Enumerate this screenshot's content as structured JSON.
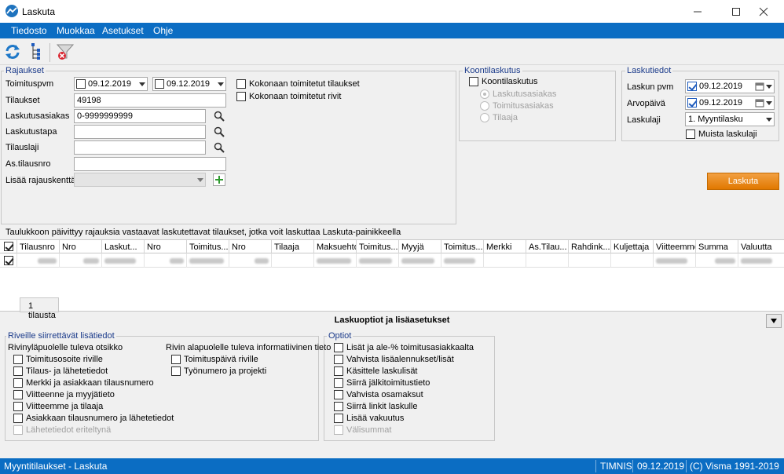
{
  "window": {
    "title": "Laskuta"
  },
  "menu": [
    "Tiedosto",
    "Muokkaa",
    "Asetukset",
    "Ohje"
  ],
  "rajaukset": {
    "title": "Rajaukset",
    "toimituspvm_label": "Toimituspvm",
    "date_from": "09.12.2019",
    "date_to": "09.12.2019",
    "tilaukset_label": "Tilaukset",
    "tilaukset_value": "49198",
    "laskutusasiakas_label": "Laskutusasiakas",
    "laskutusasiakas_value": "0-9999999999",
    "laskutustapa_label": "Laskutustapa",
    "tilauslaji_label": "Tilauslaji",
    "astilausnro_label": "As.tilausnro",
    "lisaa_label": "Lisää rajauskenttä",
    "kokonaan_tilaukset": "Kokonaan toimitetut tilaukset",
    "kokonaan_rivit": "Kokonaan toimitetut rivit"
  },
  "koonti": {
    "title": "Koontilaskutus",
    "checkbox": "Koontilaskutus",
    "options": [
      "Laskutusasiakas",
      "Toimitusasiakas",
      "Tilaaja"
    ]
  },
  "laskutiedot": {
    "title": "Laskutiedot",
    "laskun_pvm_label": "Laskun pvm",
    "laskun_pvm": "09.12.2019",
    "arvopaiva_label": "Arvopäivä",
    "arvopaiva": "09.12.2019",
    "laskulaji_label": "Laskulaji",
    "laskulaji": "1. Myyntilasku",
    "muista": "Muista laskulaji"
  },
  "laskuta_button": "Laskuta",
  "info_text": "Taulukkoon päivittyy rajauksia vastaavat laskutettavat tilaukset, jotka voit laskuttaa Laskuta-painikkeella",
  "grid": {
    "columns": [
      "Tilausnro",
      "Nro",
      "Laskut...",
      "Nro",
      "Toimitus...",
      "Nro",
      "Tilaaja",
      "Maksuehto",
      "Toimitus...",
      "Myyjä",
      "Toimitus...",
      "Merkki",
      "As.Tilau...",
      "Rahdink...",
      "Kuljettaja",
      "Viitteemme",
      "Summa",
      "Valuutta"
    ],
    "count": "1 tilausta"
  },
  "options_header": "Laskuoptiot ja lisäasetukset",
  "riveille": {
    "title": "Riveille siirrettävät lisätiedot",
    "above_title": "Rivinyläpuolelle tuleva otsikko",
    "above_items": [
      "Toimitusosoite riville",
      "Tilaus- ja lähetetiedot",
      "Merkki ja asiakkaan tilausnumero",
      "Viitteenne ja myyjätieto",
      "Viitteemme ja tilaaja",
      "Asiakkaan tilausnumero ja lähetetiedot",
      "Lähetetiedot eriteltynä"
    ],
    "below_title": "Rivin alapuolelle tuleva informatiivinen tieto",
    "below_items": [
      "Toimituspäivä riville",
      "Työnumero ja projekti"
    ]
  },
  "optiot": {
    "title": "Optiot",
    "items": [
      "Lisät ja ale-% toimitusasiakkaalta",
      "Vahvista lisäalennukset/lisät",
      "Käsittele laskulisät",
      "Siirrä jälkitoimitustieto",
      "Vahvista osamaksut",
      "Siirrä linkit laskulle",
      "Lisää vakuutus",
      "Välisummat"
    ]
  },
  "status": {
    "left": "Myyntitilaukset - Laskuta",
    "company": "TIMNIS",
    "date": "09.12.2019",
    "copyright": "(C) Visma 1991-2019"
  },
  "colors": {
    "accent": "#0b6dc3",
    "button": "#e17800"
  }
}
